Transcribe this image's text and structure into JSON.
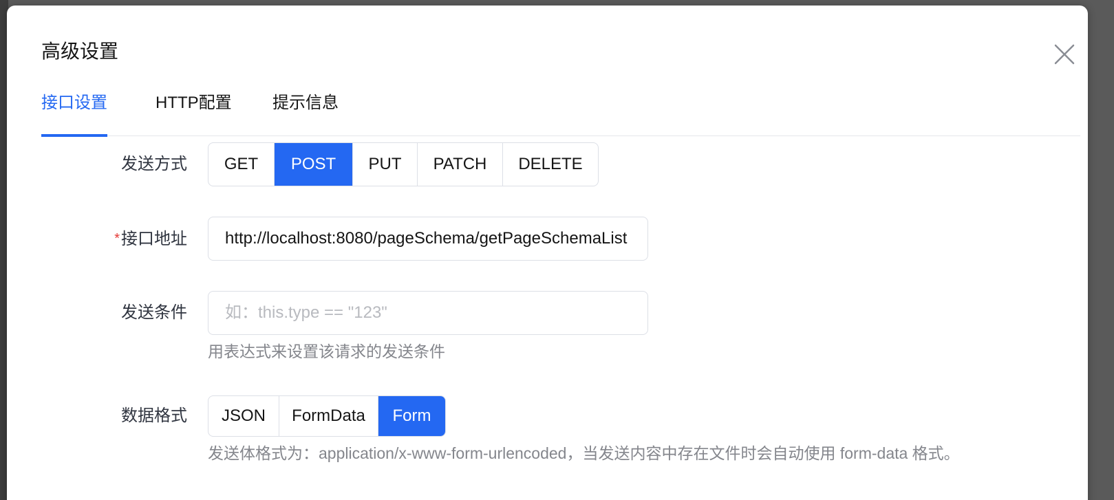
{
  "modal": {
    "title": "高级设置"
  },
  "tabs": [
    {
      "label": "接口设置",
      "active": true
    },
    {
      "label": "HTTP配置",
      "active": false
    },
    {
      "label": "提示信息",
      "active": false
    }
  ],
  "form": {
    "method": {
      "label": "发送方式",
      "options": [
        "GET",
        "POST",
        "PUT",
        "PATCH",
        "DELETE"
      ],
      "selected": "POST"
    },
    "api_url": {
      "label": "接口地址",
      "required_mark": "*",
      "value": "http://localhost:8080/pageSchema/getPageSchemaList"
    },
    "send_condition": {
      "label": "发送条件",
      "placeholder": "如：this.type == \"123\"",
      "hint": "用表达式来设置该请求的发送条件"
    },
    "data_format": {
      "label": "数据格式",
      "options": [
        "JSON",
        "FormData",
        "Form"
      ],
      "selected": "Form",
      "hint": "发送体格式为：application/x-www-form-urlencoded，当发送内容中存在文件时会自动使用 form-data 格式。"
    }
  },
  "colors": {
    "accent": "#2468f2",
    "required": "#e53935"
  }
}
